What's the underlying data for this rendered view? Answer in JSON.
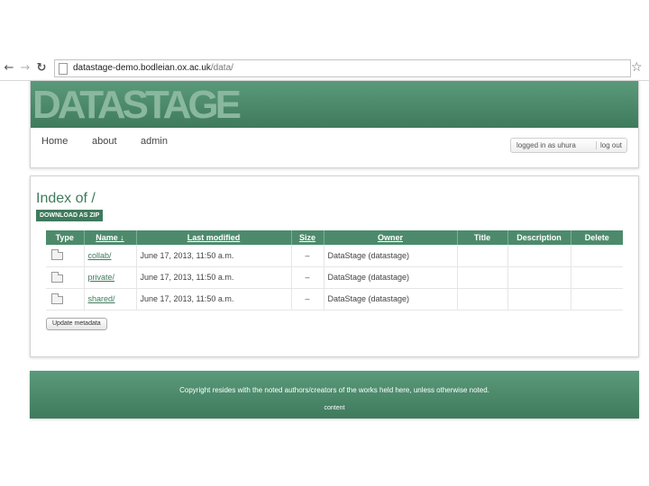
{
  "browser": {
    "url_host": "datastage-demo.bodleian.ox.ac.uk",
    "url_path": "/data/",
    "icons": [
      "back-arrow-icon",
      "forward-arrow-icon",
      "reload-icon",
      "page-icon",
      "bookmark-star-icon"
    ]
  },
  "header": {
    "logo": "DATASTAGE",
    "nav": {
      "home": "Home",
      "about": "about",
      "admin": "admin"
    },
    "login": {
      "status": "logged in as uhura",
      "logout": "log out"
    }
  },
  "main": {
    "title": "Index of /",
    "zip_button": "DOWNLOAD AS ZIP",
    "table": {
      "columns": [
        "Type",
        "Name ↓",
        "Last modified",
        "Size",
        "Owner",
        "Title",
        "Description",
        "Delete"
      ],
      "rows": [
        {
          "type": "folder-icon",
          "name": "collab/",
          "modified": "June 17, 2013, 11:50 a.m.",
          "size": "–",
          "owner": "DataStage (datastage)",
          "title": "",
          "description": "",
          "delete": ""
        },
        {
          "type": "folder-icon",
          "name": "private/",
          "modified": "June 17, 2013, 11:50 a.m.",
          "size": "–",
          "owner": "DataStage (datastage)",
          "title": "",
          "description": "",
          "delete": ""
        },
        {
          "type": "folder-icon",
          "name": "shared/",
          "modified": "June 17, 2013, 11:50 a.m.",
          "size": "–",
          "owner": "DataStage (datastage)",
          "title": "",
          "description": "",
          "delete": ""
        }
      ]
    },
    "update_button": "Update metadata"
  },
  "footer": {
    "copyright": "Copyright resides with the noted authors/creators of the works held here, unless otherwise noted.",
    "link": "content"
  },
  "colors": {
    "brand": "#4d8a6c",
    "brand_dark": "#3f7a5d",
    "logo": "#8ab89f"
  }
}
